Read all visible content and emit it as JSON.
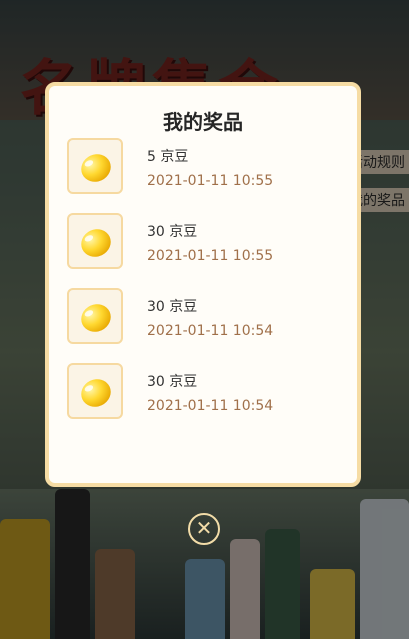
{
  "background": {
    "banner_title": "名牌集合",
    "side_text_1": "活动规则",
    "side_text_2": "我的奖品"
  },
  "modal": {
    "title": "我的奖品",
    "prizes": [
      {
        "name": "5 京豆",
        "time": "2021-01-11 10:55",
        "icon": "jingdou-bean-icon"
      },
      {
        "name": "30 京豆",
        "time": "2021-01-11 10:55",
        "icon": "jingdou-bean-icon"
      },
      {
        "name": "30 京豆",
        "time": "2021-01-11 10:54",
        "icon": "jingdou-bean-icon"
      },
      {
        "name": "30 京豆",
        "time": "2021-01-11 10:54",
        "icon": "jingdou-bean-icon"
      }
    ]
  },
  "close_icon": "close-icon",
  "colors": {
    "accent_border": "#f6dca4",
    "time_text": "#a0704a",
    "bean_gold": "#ffd830"
  }
}
